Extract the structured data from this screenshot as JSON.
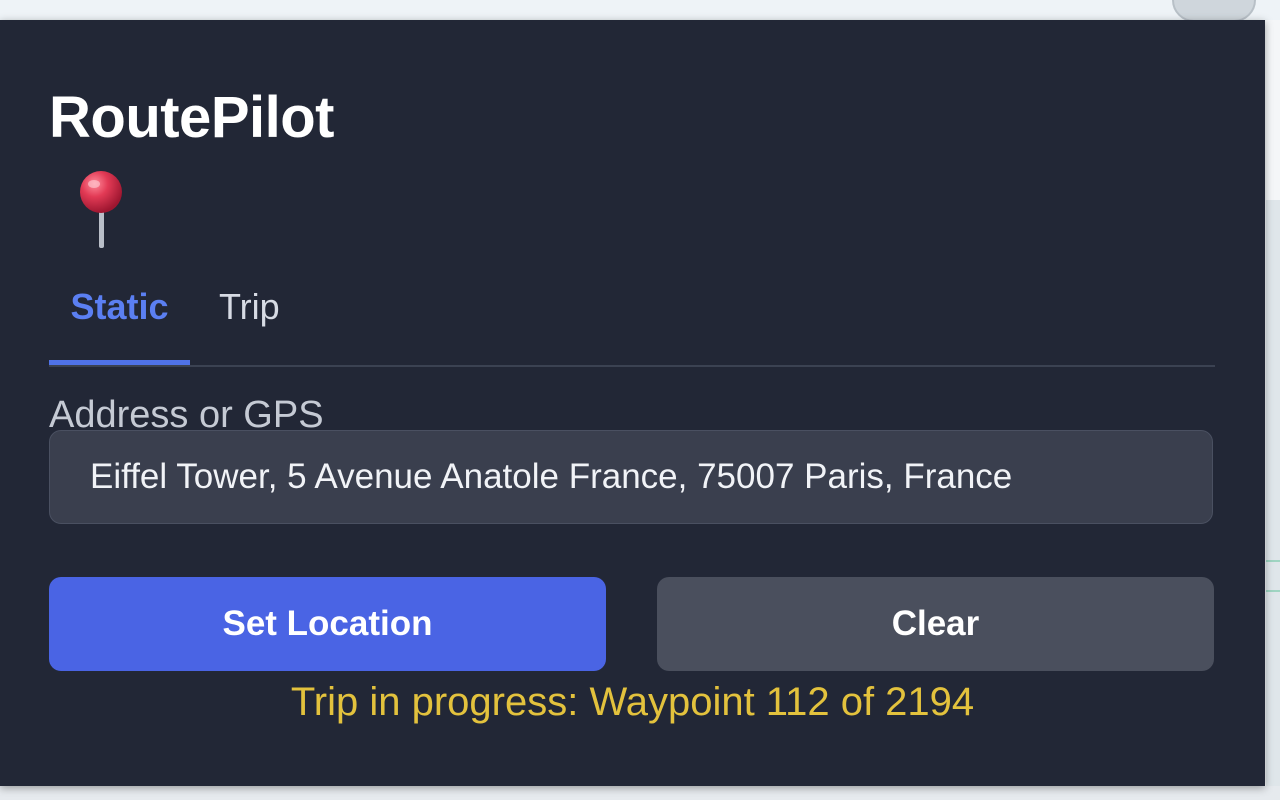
{
  "app": {
    "title": "RoutePilot",
    "logo_icon": "map-pin-icon"
  },
  "tabs": [
    {
      "label": "Static",
      "active": true
    },
    {
      "label": "Trip",
      "active": false
    }
  ],
  "form": {
    "address_label": "Address or GPS",
    "address_value": "Eiffel Tower, 5 Avenue Anatole France, 75007 Paris, France"
  },
  "buttons": {
    "set_location": "Set Location",
    "clear": "Clear"
  },
  "status": {
    "text": "Trip in progress: Waypoint 112 of 2194",
    "current_waypoint": 112,
    "total_waypoints": 2194
  },
  "colors": {
    "panel_bg": "#222736",
    "accent": "#4a64e4",
    "active_tab": "#5b7ff2",
    "status_text": "#e3c23d"
  }
}
